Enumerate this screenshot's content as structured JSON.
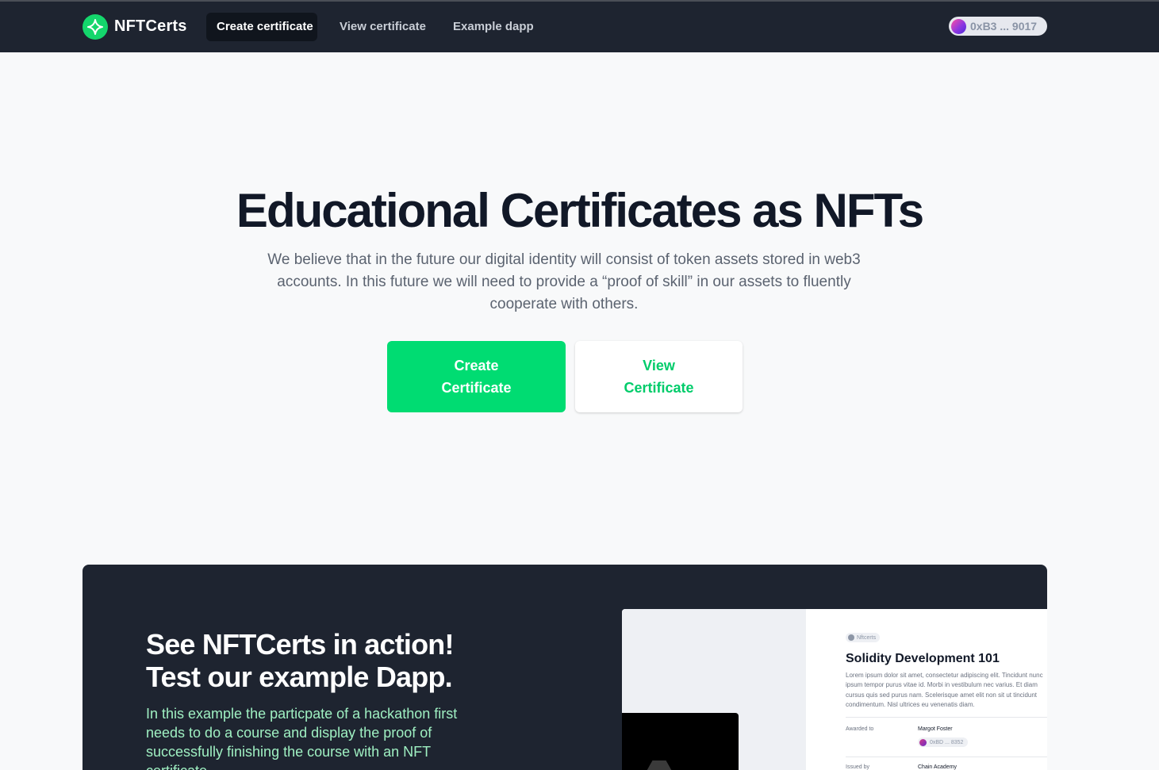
{
  "nav": {
    "brand": "NFTCerts",
    "links": [
      {
        "label": "Create certificate",
        "active": true
      },
      {
        "label": "View certificate",
        "active": false
      },
      {
        "label": "Example dapp",
        "active": false
      }
    ],
    "wallet_address": "0xB3 ... 9017",
    "icons": {
      "logo": "sparkle-icon"
    }
  },
  "hero": {
    "title": "Educational Certificates as NFTs",
    "subtitle": "We believe that in the future our digital identity will consist of token assets stored in web3 accounts. In this future we will need to provide a “proof of skill” in our assets to fluently cooperate with others.",
    "create_button": "Create Certificate",
    "view_button": "View Certificate"
  },
  "demo": {
    "title_line1": "See NFTCerts in action!",
    "title_line2": "Test our example Dapp.",
    "text": "In this example the particpate of a hackathon first needs to do a course and display the proof of successfully finishing the course with an NFT certificate.",
    "preview": {
      "badge": "Nftcerts",
      "title": "Solidity Development 101",
      "description": "Lorem ipsum dolor sit amet, consectetur adipiscing elit. Tincidunt nunc ipsum tempor purus vitae id. Morbi in vestibulum nec varius. Et diam cursus quis sed purus nam. Scelerisque amet elit non sit ut tincidunt condimentum. Nisl ultrices eu venenatis diam.",
      "awarded_label": "Awarded to",
      "awarded_name": "Margot Foster",
      "awarded_address": "0xBD ... 8352",
      "issued_label": "Issued by",
      "issued_value": "Chain Academy"
    }
  },
  "colors": {
    "nav_bg": "#1e2430",
    "accent_green": "#00dc72",
    "page_bg": "#f8f9fa",
    "demo_text_green": "#9ff0c2"
  }
}
